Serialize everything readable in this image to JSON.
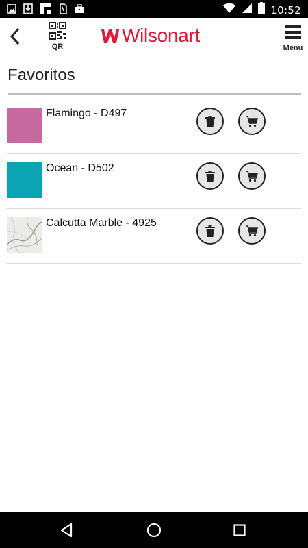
{
  "status_bar": {
    "time": "10:52",
    "left_icons": [
      "image-icon",
      "download-icon",
      "flipboard-icon",
      "sim-icon",
      "briefcase-icon"
    ],
    "right_icons": [
      "wifi-icon",
      "signal-icon",
      "battery-icon"
    ]
  },
  "app_bar": {
    "qr_label": "QR",
    "logo_text": "Wilsonart",
    "menu_label": "Menú",
    "brand_color": "#e31837"
  },
  "page": {
    "title": "Favoritos"
  },
  "favorites": [
    {
      "name": "Flamingo - D497",
      "swatch": "#c76aa0"
    },
    {
      "name": "Ocean - D502",
      "swatch": "#0aa4b3"
    },
    {
      "name": "Calcutta Marble - 4925",
      "swatch": "marble"
    }
  ],
  "nav_bar": {
    "icons": [
      "back-triangle-icon",
      "home-circle-icon",
      "recents-square-icon"
    ]
  }
}
